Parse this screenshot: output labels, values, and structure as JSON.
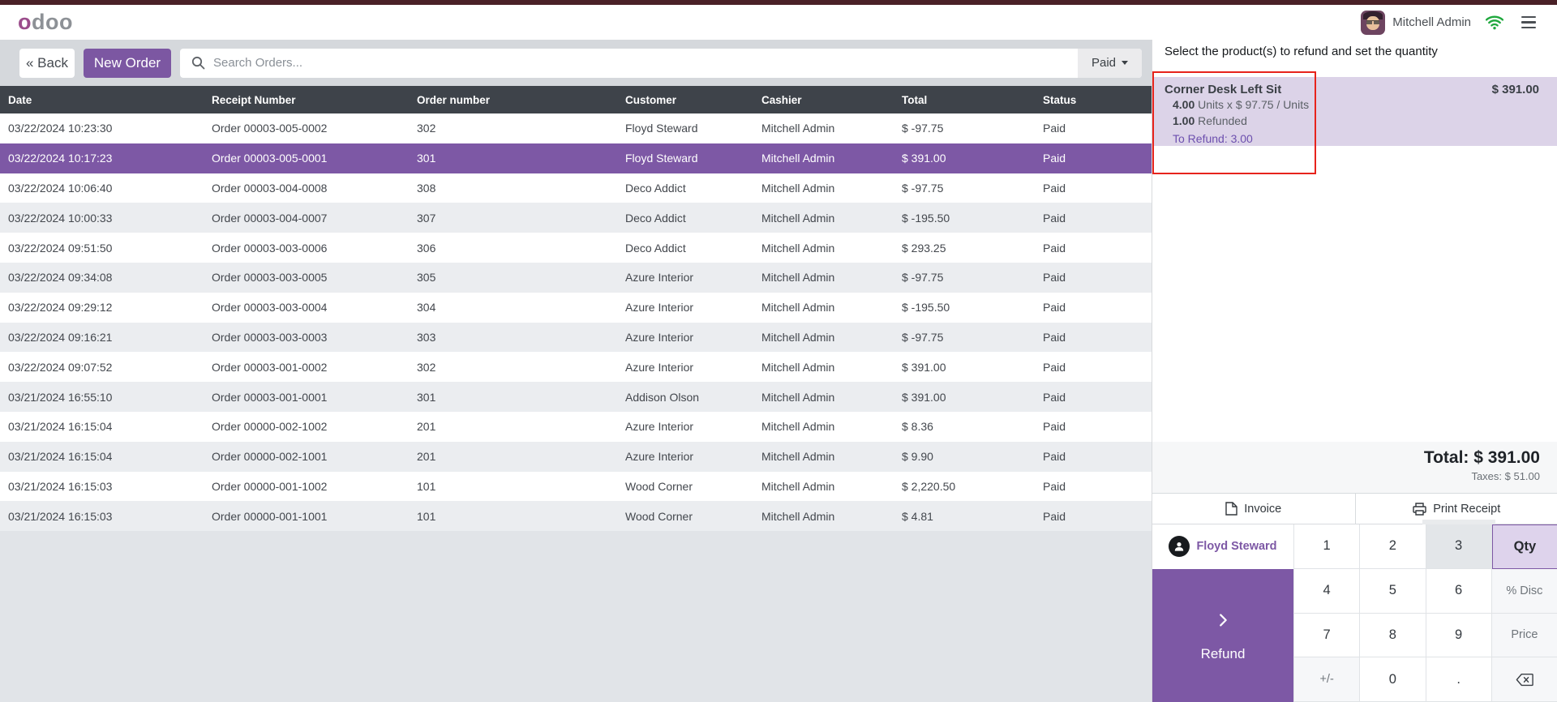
{
  "topbar": {
    "logo": "odoo",
    "user_name": "Mitchell Admin"
  },
  "toolbar": {
    "back_label": "« Back",
    "new_order_label": "New Order",
    "search_placeholder": "Search Orders...",
    "filter_label": "Paid"
  },
  "orders_table": {
    "columns": [
      "Date",
      "Receipt Number",
      "Order number",
      "Customer",
      "Cashier",
      "Total",
      "Status"
    ],
    "selected_index": 1,
    "rows": [
      {
        "date": "03/22/2024 10:23:30",
        "receipt": "Order 00003-005-0002",
        "order": "302",
        "customer": "Floyd Steward",
        "cashier": "Mitchell Admin",
        "total": "$ -97.75",
        "status": "Paid"
      },
      {
        "date": "03/22/2024 10:17:23",
        "receipt": "Order 00003-005-0001",
        "order": "301",
        "customer": "Floyd Steward",
        "cashier": "Mitchell Admin",
        "total": "$ 391.00",
        "status": "Paid"
      },
      {
        "date": "03/22/2024 10:06:40",
        "receipt": "Order 00003-004-0008",
        "order": "308",
        "customer": "Deco Addict",
        "cashier": "Mitchell Admin",
        "total": "$ -97.75",
        "status": "Paid"
      },
      {
        "date": "03/22/2024 10:00:33",
        "receipt": "Order 00003-004-0007",
        "order": "307",
        "customer": "Deco Addict",
        "cashier": "Mitchell Admin",
        "total": "$ -195.50",
        "status": "Paid"
      },
      {
        "date": "03/22/2024 09:51:50",
        "receipt": "Order 00003-003-0006",
        "order": "306",
        "customer": "Deco Addict",
        "cashier": "Mitchell Admin",
        "total": "$ 293.25",
        "status": "Paid"
      },
      {
        "date": "03/22/2024 09:34:08",
        "receipt": "Order 00003-003-0005",
        "order": "305",
        "customer": "Azure Interior",
        "cashier": "Mitchell Admin",
        "total": "$ -97.75",
        "status": "Paid"
      },
      {
        "date": "03/22/2024 09:29:12",
        "receipt": "Order 00003-003-0004",
        "order": "304",
        "customer": "Azure Interior",
        "cashier": "Mitchell Admin",
        "total": "$ -195.50",
        "status": "Paid"
      },
      {
        "date": "03/22/2024 09:16:21",
        "receipt": "Order 00003-003-0003",
        "order": "303",
        "customer": "Azure Interior",
        "cashier": "Mitchell Admin",
        "total": "$ -97.75",
        "status": "Paid"
      },
      {
        "date": "03/22/2024 09:07:52",
        "receipt": "Order 00003-001-0002",
        "order": "302",
        "customer": "Azure Interior",
        "cashier": "Mitchell Admin",
        "total": "$ 391.00",
        "status": "Paid"
      },
      {
        "date": "03/21/2024 16:55:10",
        "receipt": "Order 00003-001-0001",
        "order": "301",
        "customer": "Addison Olson",
        "cashier": "Mitchell Admin",
        "total": "$ 391.00",
        "status": "Paid"
      },
      {
        "date": "03/21/2024 16:15:04",
        "receipt": "Order 00000-002-1002",
        "order": "201",
        "customer": "Azure Interior",
        "cashier": "Mitchell Admin",
        "total": "$ 8.36",
        "status": "Paid"
      },
      {
        "date": "03/21/2024 16:15:04",
        "receipt": "Order 00000-002-1001",
        "order": "201",
        "customer": "Azure Interior",
        "cashier": "Mitchell Admin",
        "total": "$ 9.90",
        "status": "Paid"
      },
      {
        "date": "03/21/2024 16:15:03",
        "receipt": "Order 00000-001-1002",
        "order": "101",
        "customer": "Wood Corner",
        "cashier": "Mitchell Admin",
        "total": "$ 2,220.50",
        "status": "Paid"
      },
      {
        "date": "03/21/2024 16:15:03",
        "receipt": "Order 00000-001-1001",
        "order": "101",
        "customer": "Wood Corner",
        "cashier": "Mitchell Admin",
        "total": "$ 4.81",
        "status": "Paid"
      }
    ]
  },
  "refund_panel": {
    "instruction": "Select the product(s) to refund and set the quantity",
    "product": {
      "name": "Corner Desk Left Sit",
      "qty": "4.00",
      "qty_unit": "Units x $ 97.75 / Units",
      "refunded_qty": "1.00",
      "refunded_label": "Refunded",
      "to_refund": "To Refund: 3.00",
      "price": "$ 391.00"
    },
    "total_label": "Total: $ 391.00",
    "taxes_label": "Taxes: $ 51.00",
    "invoice_label": "Invoice",
    "print_label": "Print Receipt",
    "customer_name": "Floyd Steward",
    "refund_label": "Refund",
    "numpad": [
      {
        "label": "1",
        "state": "num"
      },
      {
        "label": "2",
        "state": "num"
      },
      {
        "label": "3",
        "state": "pressed"
      },
      {
        "label": "Qty",
        "state": "selected"
      },
      {
        "label": "4",
        "state": "num"
      },
      {
        "label": "5",
        "state": "num"
      },
      {
        "label": "6",
        "state": "num"
      },
      {
        "label": "% Disc",
        "state": "mode"
      },
      {
        "label": "7",
        "state": "num"
      },
      {
        "label": "8",
        "state": "num"
      },
      {
        "label": "9",
        "state": "num"
      },
      {
        "label": "Price",
        "state": "mode"
      },
      {
        "label": "+/-",
        "state": "mode"
      },
      {
        "label": "0",
        "state": "num"
      },
      {
        "label": ".",
        "state": "num"
      },
      {
        "label": "⌫",
        "state": "mode"
      }
    ]
  },
  "colors": {
    "primary": "#7c57a2",
    "selected_row": "#7d58a5",
    "annotation_red": "#e7231c",
    "table_header": "#3e434a",
    "product_card_bg": "#dcd3e8",
    "wifi_green": "#1fa83d",
    "top_strip": "#4a2127"
  }
}
